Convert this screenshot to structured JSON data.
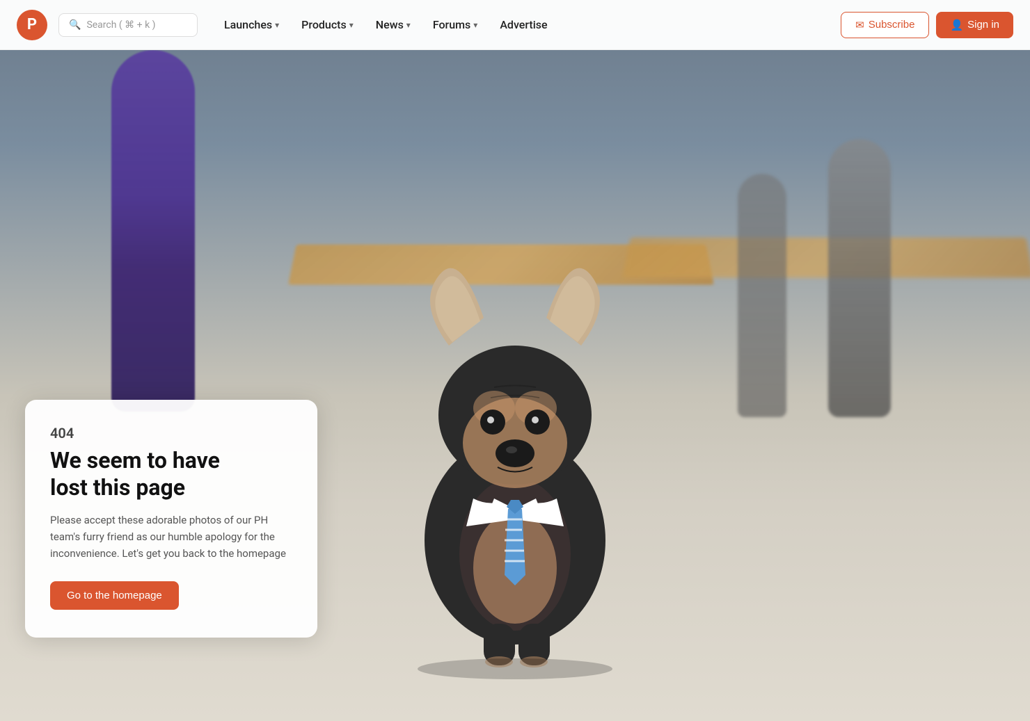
{
  "nav": {
    "logo_letter": "P",
    "search_placeholder": "Search ( ⌘ + k )",
    "links": [
      {
        "label": "Launches",
        "has_chevron": true
      },
      {
        "label": "Products",
        "has_chevron": true
      },
      {
        "label": "News",
        "has_chevron": true
      },
      {
        "label": "Forums",
        "has_chevron": true
      },
      {
        "label": "Advertise",
        "has_chevron": false
      }
    ],
    "subscribe_label": "Subscribe",
    "signin_label": "Sign in"
  },
  "error": {
    "code": "404",
    "heading_line1": "We seem to have",
    "heading_line2": "lost this page",
    "description": "Please accept these adorable photos of our PH team's furry friend as our humble apology for the inconvenience. Let's get you back to the homepage",
    "cta_label": "Go to the homepage"
  },
  "colors": {
    "brand": "#da552f",
    "text_dark": "#111111",
    "text_medium": "#444444",
    "text_light": "#555555"
  }
}
